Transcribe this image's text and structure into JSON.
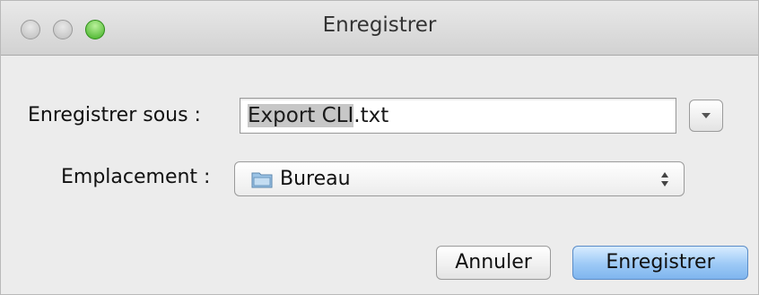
{
  "window": {
    "title": "Enregistrer"
  },
  "form": {
    "save_as_label": "Enregistrer sous :",
    "filename_selected": "Export CLI",
    "filename_ext": ".txt",
    "location_label": "Emplacement :",
    "location_value": "Bureau"
  },
  "buttons": {
    "cancel_label": "Annuler",
    "save_label": "Enregistrer"
  },
  "icons": {
    "close": "close-icon",
    "minimize": "minimize-icon",
    "zoom": "zoom-icon",
    "expand": "chevron-down-icon",
    "folder": "folder-icon",
    "updown": "updown-arrows-icon"
  },
  "colors": {
    "default_button": "#9cc9f6",
    "zoom": "#3fae22"
  }
}
